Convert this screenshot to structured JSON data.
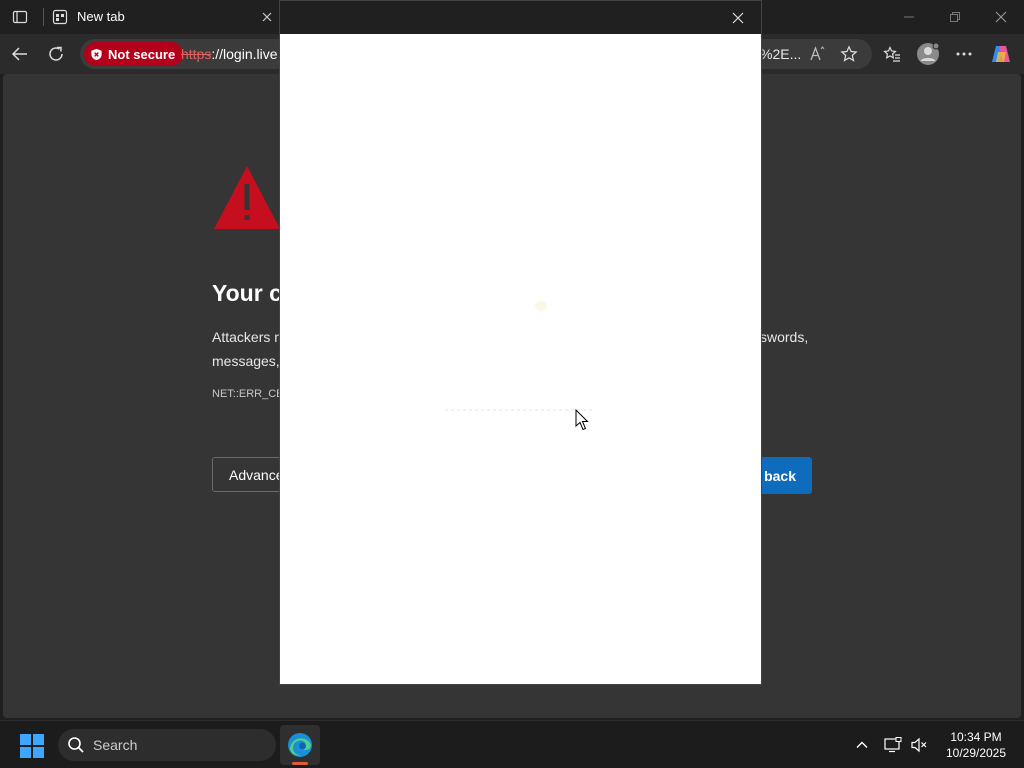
{
  "browser": {
    "tab": {
      "title": "New tab"
    },
    "address": {
      "security_badge": "Not secure",
      "url_scheme": "https",
      "url_host": "://login.live",
      "url_tail": "%2E..."
    },
    "icons": {
      "sidebar_toggle": "tab-actions-icon",
      "favicon": "new-tab-icon",
      "back": "back-arrow-icon",
      "refresh": "refresh-icon",
      "read_aloud": "read-aloud-icon",
      "favorite": "star-icon",
      "favorites": "favorites-icon",
      "profile": "profile-icon",
      "more": "more-icon",
      "copilot": "copilot-icon"
    }
  },
  "error_page": {
    "heading": "Your c",
    "body_line1": "Attackers n",
    "body_line1_right": "sswords,",
    "body_line2": "messages, ",
    "error_code": "NET::ERR_CE",
    "advanced_label": "Advance",
    "back_label": "back"
  },
  "taskbar": {
    "search_label": "Search",
    "time": "10:34 PM",
    "date": "10/29/2025"
  },
  "colors": {
    "accent_blue": "#0f6cbd",
    "warning_red": "#c50f1f",
    "not_secure_bg": "#b3001b"
  }
}
